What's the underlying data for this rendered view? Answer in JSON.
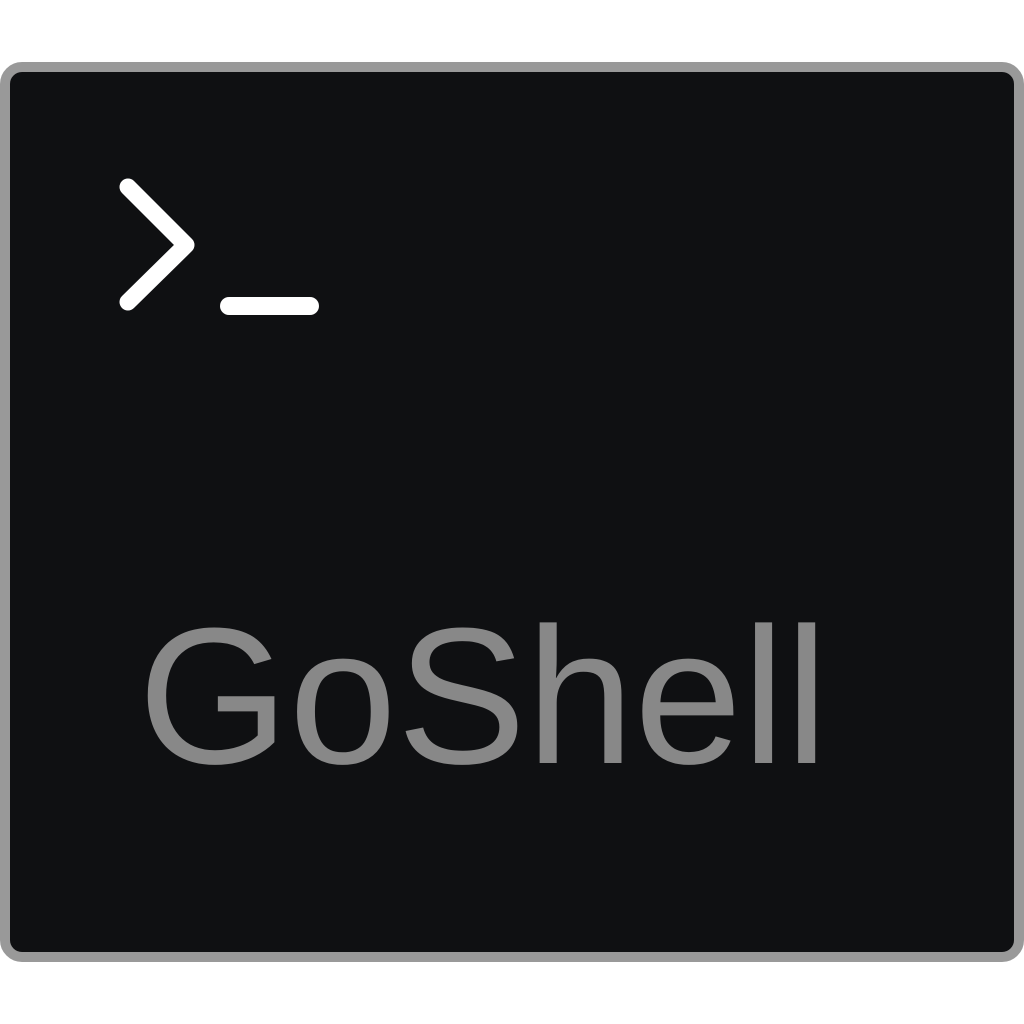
{
  "app": {
    "name": "GoShell",
    "icon": "terminal-prompt-icon"
  },
  "colors": {
    "frame_border": "#999999",
    "background": "#0f1012",
    "prompt": "#ffffff",
    "name_text": "#888888"
  }
}
